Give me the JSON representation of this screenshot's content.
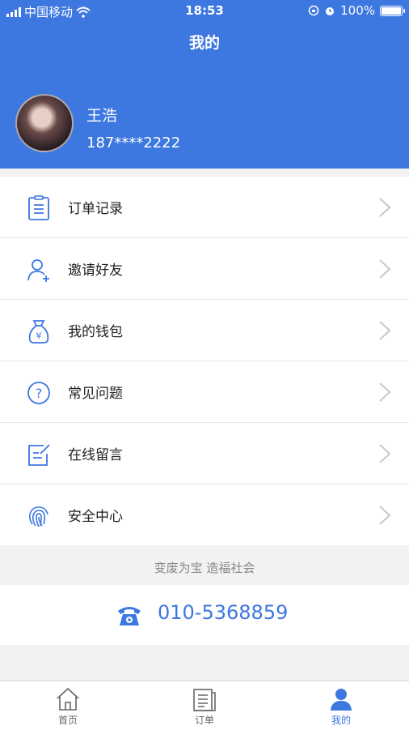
{
  "status_bar": {
    "carrier": "中国移动",
    "time": "18:53",
    "battery": "100%"
  },
  "header": {
    "title": "我的",
    "user_name": "王浩",
    "user_phone": "187****2222"
  },
  "menu": [
    {
      "label": "订单记录",
      "icon": "order-list-icon"
    },
    {
      "label": "邀请好友",
      "icon": "invite-friend-icon"
    },
    {
      "label": "我的钱包",
      "icon": "wallet-icon"
    },
    {
      "label": "常见问题",
      "icon": "question-icon"
    },
    {
      "label": "在线留言",
      "icon": "edit-note-icon"
    },
    {
      "label": "安全中心",
      "icon": "fingerprint-icon"
    }
  ],
  "footer": {
    "slogan": "变废为宝 造福社会",
    "hotline": "010-5368859"
  },
  "tabbar": [
    {
      "label": "首页",
      "icon": "home-icon"
    },
    {
      "label": "订单",
      "icon": "orders-icon"
    },
    {
      "label": "我的",
      "icon": "profile-icon"
    }
  ],
  "colors": {
    "primary": "#3d77e0",
    "background": "#f2f2f2"
  }
}
